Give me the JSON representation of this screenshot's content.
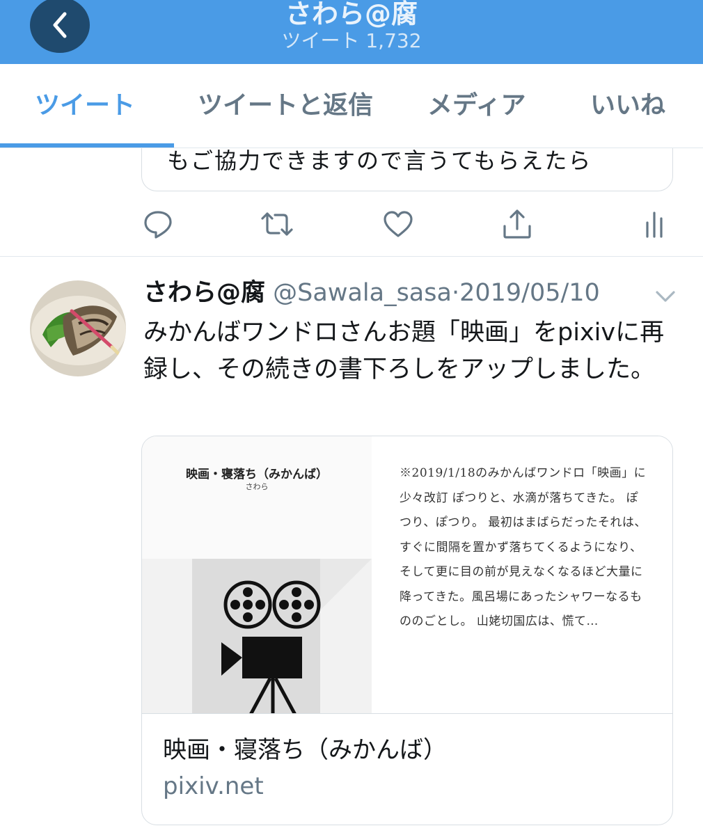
{
  "header": {
    "title": "さわら@腐",
    "subtitle": "ツイート 1,732"
  },
  "tabs": [
    {
      "label": "ツイート",
      "active": true
    },
    {
      "label": "ツイートと返信",
      "active": false
    },
    {
      "label": "メディア",
      "active": false
    },
    {
      "label": "いいね",
      "active": false
    }
  ],
  "previous_tweet": {
    "card_text": "もご協力できますので言うてもらえたら",
    "actions": [
      "reply-icon",
      "retweet-icon",
      "like-icon",
      "share-icon",
      "analytics-icon"
    ]
  },
  "tweet": {
    "name": "さわら@腐",
    "handle": "@Sawala_sasa",
    "separator": "·",
    "date": "2019/05/10",
    "text": "みかんばワンドロさんお題「映画」をpixivに再録し、その続きの書下ろしをアップしました。",
    "card": {
      "doc_title": "映画・寝落ち（みかんば）",
      "doc_author": "さわら",
      "excerpt": "※2019/1/18のみかんばワンドロ「映画」に少々改訂 ぽつりと、水滴が落ちてきた。 ぽつり、ぽつり。 最初はまばらだったそれは、すぐに間隔を置かず落ちてくるようになり、そして更に目の前が見えなくなるほど大量に降ってきた。風呂場にあったシャワーなるもののごとし。 山姥切国広は、慌て…",
      "title": "映画・寝落ち（みかんば）",
      "domain": "pixiv.net"
    }
  },
  "colors": {
    "accent": "#4a9be6",
    "back_button": "#1f4a6e",
    "muted": "#657786"
  }
}
